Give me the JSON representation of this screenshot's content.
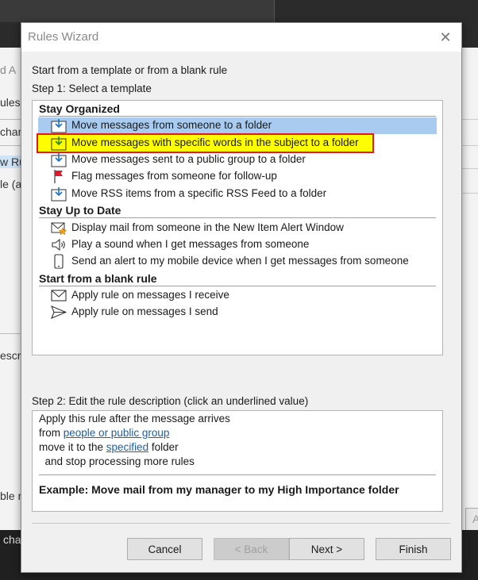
{
  "parent": {
    "fragments": [
      "d A",
      "ules",
      "chan",
      "w Ru",
      "le (a",
      "escri",
      "ble r",
      "cha",
      "A"
    ]
  },
  "dialog": {
    "title": "Rules Wizard",
    "intro": "Start from a template or from a blank rule",
    "step1": "Step 1: Select a template",
    "groups": [
      {
        "header": "Stay Organized",
        "items": [
          {
            "label": "Move messages from someone to a folder",
            "icon": "move-to-folder-icon",
            "state": "selected"
          },
          {
            "label": "Move messages with specific words in the subject to a folder",
            "icon": "move-to-folder-icon",
            "state": "highlighted"
          },
          {
            "label": "Move messages sent to a public group to a folder",
            "icon": "move-to-folder-icon",
            "state": "normal"
          },
          {
            "label": "Flag messages from someone for follow-up",
            "icon": "flag-icon",
            "state": "normal"
          },
          {
            "label": "Move RSS items from a specific RSS Feed to a folder",
            "icon": "move-to-folder-icon",
            "state": "normal"
          }
        ]
      },
      {
        "header": "Stay Up to Date",
        "items": [
          {
            "label": "Display mail from someone in the New Item Alert Window",
            "icon": "mail-alert-icon",
            "state": "normal"
          },
          {
            "label": "Play a sound when I get messages from someone",
            "icon": "speaker-icon",
            "state": "normal"
          },
          {
            "label": "Send an alert to my mobile device when I get messages from someone",
            "icon": "mobile-phone-icon",
            "state": "normal"
          }
        ]
      },
      {
        "header": "Start from a blank rule",
        "items": [
          {
            "label": "Apply rule on messages I receive",
            "icon": "envelope-icon",
            "state": "normal"
          },
          {
            "label": "Apply rule on messages I send",
            "icon": "send-icon",
            "state": "normal"
          }
        ]
      }
    ],
    "step2": "Step 2: Edit the rule description (click an underlined value)",
    "description": {
      "line1": "Apply this rule after the message arrives",
      "line2_prefix": "from ",
      "line2_link": "people or public group",
      "line3_prefix": "move it to the ",
      "line3_link": "specified",
      "line3_suffix": " folder",
      "line4": "  and stop processing more rules",
      "example": "Example: Move mail from my manager to my High Importance folder"
    },
    "buttons": {
      "cancel": "Cancel",
      "back": "< Back",
      "next": "Next >",
      "finish": "Finish"
    },
    "colors": {
      "selected_row": "#a8cbef",
      "highlight_fill": "#ffff00",
      "highlight_border": "#e0182a",
      "link": "#1d5fa6"
    }
  }
}
